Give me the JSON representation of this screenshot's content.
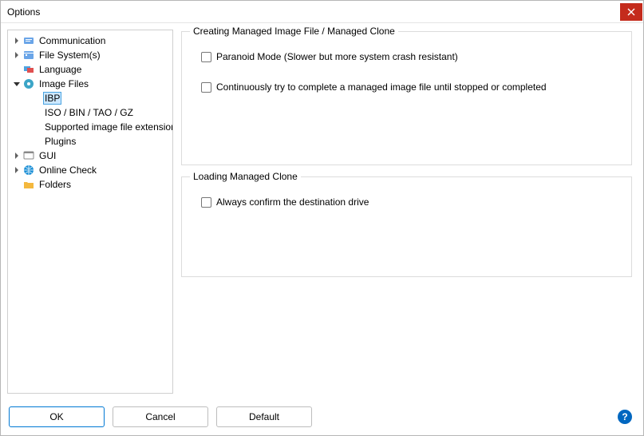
{
  "window": {
    "title": "Options"
  },
  "tree": {
    "items": [
      {
        "label": "Communication",
        "chevron": "right",
        "icon": "comm"
      },
      {
        "label": "File System(s)",
        "chevron": "right",
        "icon": "fs"
      },
      {
        "label": "Language",
        "chevron": "none",
        "icon": "lang"
      },
      {
        "label": "Image Files",
        "chevron": "down",
        "icon": "image"
      },
      {
        "label": "IBP",
        "chevron": "none",
        "icon": "",
        "indent": 2,
        "selected": true
      },
      {
        "label": "ISO / BIN / TAO / GZ",
        "chevron": "none",
        "icon": "",
        "indent": 2
      },
      {
        "label": "Supported image file extension",
        "chevron": "none",
        "icon": "",
        "indent": 2
      },
      {
        "label": "Plugins",
        "chevron": "none",
        "icon": "",
        "indent": 2
      },
      {
        "label": "GUI",
        "chevron": "right",
        "icon": "gui"
      },
      {
        "label": "Online Check",
        "chevron": "right",
        "icon": "online"
      },
      {
        "label": "Folders",
        "chevron": "none",
        "icon": "folder"
      }
    ]
  },
  "groups": {
    "creating": {
      "title": "Creating Managed Image File / Managed Clone",
      "opts": [
        "Paranoid Mode (Slower but more system crash resistant)",
        "Continuously try to complete a managed image file until stopped or completed"
      ]
    },
    "loading": {
      "title": "Loading Managed Clone",
      "opts": [
        "Always confirm the destination drive"
      ]
    }
  },
  "buttons": {
    "ok": "OK",
    "cancel": "Cancel",
    "default": "Default"
  }
}
